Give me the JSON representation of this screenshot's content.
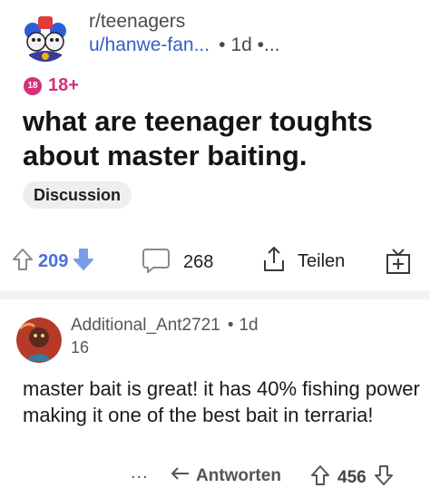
{
  "post": {
    "subreddit": "r/teenagers",
    "author": "u/hanwe-fan...",
    "separator": "•",
    "age": "1d",
    "more": "•...",
    "nsfw_icon_text": "18",
    "nsfw_label": "18+",
    "title": "what are teenager toughts about master baiting.",
    "flair": "Discussion",
    "upvotes": "209",
    "comments": "268",
    "share_label": "Teilen",
    "icons": {
      "upvote": "upvote-arrow-icon",
      "downvote": "downvote-arrow-icon",
      "comments": "comment-bubble-icon",
      "share": "share-icon",
      "award": "award-gift-icon"
    }
  },
  "comment": {
    "author": "Additional_Ant2721",
    "separator": "•",
    "age": "1d",
    "flair": "16",
    "body": "master bait is great! it has 40% fishing power making it one of the best bait in terraria!",
    "more": "...",
    "reply_label": "Antworten",
    "score": "456"
  },
  "colors": {
    "nsfw": "#d4317a",
    "upvote_active": "#4a6fd8",
    "username_link": "#3560c9"
  }
}
